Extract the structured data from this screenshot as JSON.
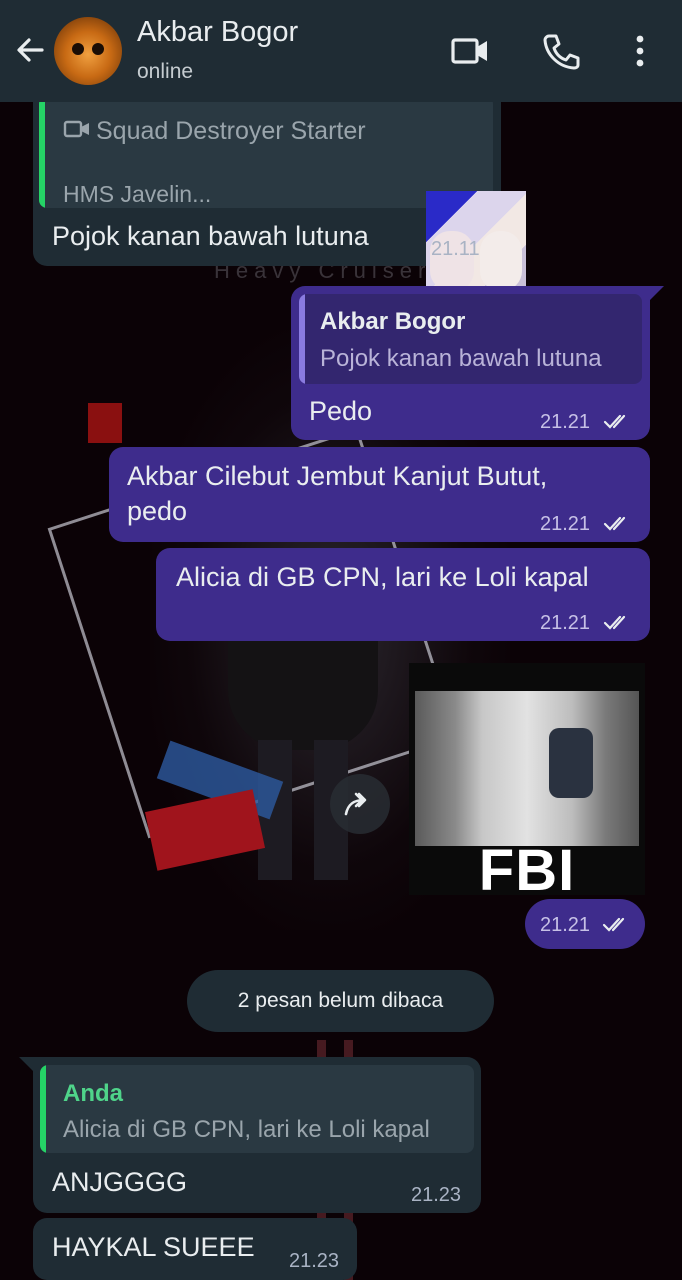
{
  "header": {
    "contact_name": "Akbar Bogor",
    "status": "online"
  },
  "messages": [
    {
      "type": "incoming",
      "quote": {
        "title": "Squad Destroyer Starter",
        "subtitle": "HMS Javelin...",
        "icon": "video-icon",
        "bar_color": "#25d366"
      },
      "text": "Pojok kanan bawah lutuna",
      "time": "21.11"
    },
    {
      "type": "outgoing",
      "quote": {
        "author": "Akbar Bogor",
        "text": "Pojok kanan bawah lutuna",
        "bar_color": "#8a7be0"
      },
      "text": "Pedo",
      "time": "21.21",
      "read": true
    },
    {
      "type": "outgoing",
      "text_lines": [
        "Akbar Cilebut Jembut Kanjut Butut,",
        "pedo"
      ],
      "time": "21.21",
      "read": true
    },
    {
      "type": "outgoing",
      "text": "Alicia di GB CPN, lari ke Loli kapal",
      "time": "21.21",
      "read": true
    },
    {
      "type": "outgoing-image",
      "caption_in_image": "FBI",
      "time": "21.21",
      "read": true
    },
    {
      "type": "incoming",
      "quote": {
        "author": "Anda",
        "text": "Alicia di GB CPN, lari ke Loli kapal",
        "bar_color": "#25d366"
      },
      "text": "ANJGGGG",
      "time": "21.23"
    },
    {
      "type": "incoming",
      "text": "HAYKAL SUEEE",
      "time": "21.23"
    }
  ],
  "unread_label": "2 pesan belum dibaca",
  "wallpaper_text": "Heavy Cruiser",
  "colors": {
    "header_bg": "#1f2c34",
    "incoming_bg": "#1f2c34",
    "outgoing_bg": "#3e2c8c",
    "read_tick": "#e9edef"
  }
}
